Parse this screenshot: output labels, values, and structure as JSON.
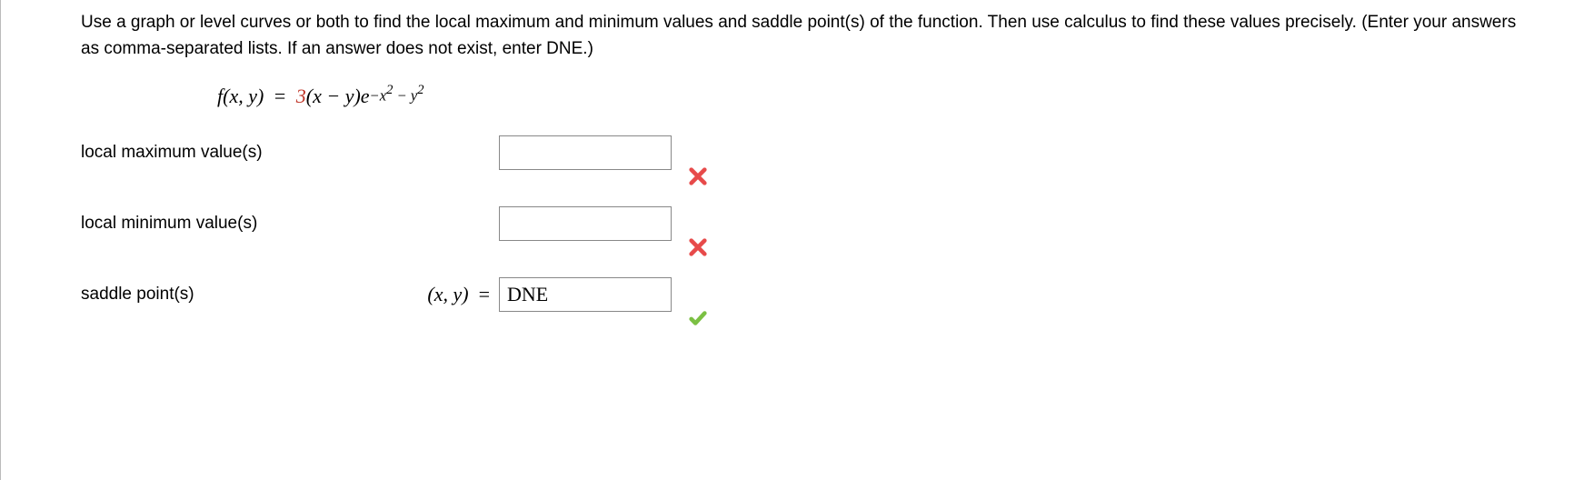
{
  "instructions": "Use a graph or level curves or both to find the local maximum and minimum values and saddle point(s) of the function. Then use calculus to find these values precisely. (Enter your answers as comma-separated lists. If an answer does not exist, enter DNE.)",
  "equation": {
    "lhs": "f(x, y)",
    "coefficient": "3",
    "base_expr": "(x − y)e",
    "exponent": "−x² − y²"
  },
  "answers": {
    "local_max": {
      "label": "local maximum value(s)",
      "value": "",
      "mark": "wrong"
    },
    "local_min": {
      "label": "local minimum value(s)",
      "value": "",
      "mark": "wrong"
    },
    "saddle": {
      "label": "saddle point(s)",
      "prefix": "(x, y)  =",
      "value": "DNE",
      "mark": "correct"
    }
  }
}
